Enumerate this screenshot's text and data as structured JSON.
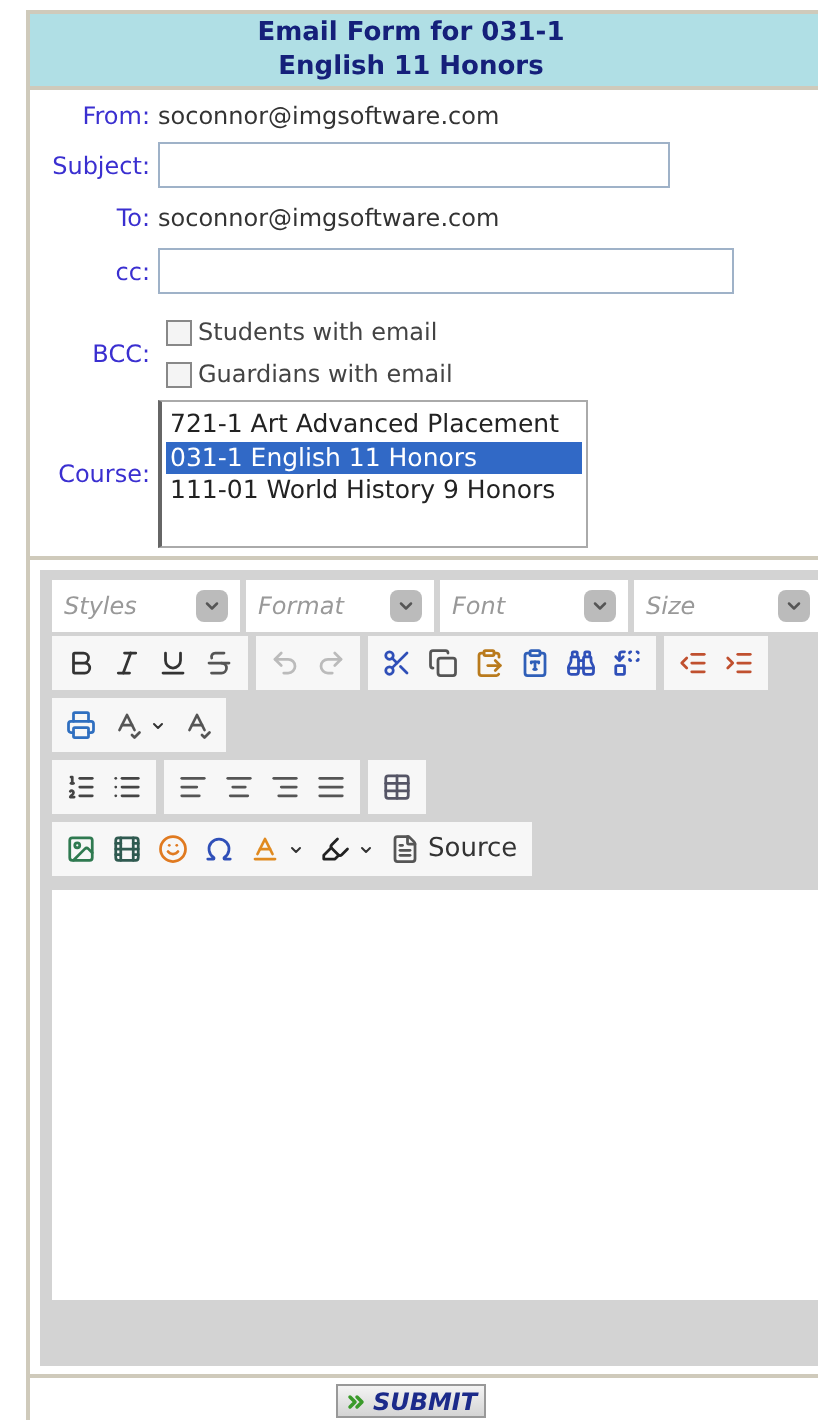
{
  "header": {
    "title": "Email Form for 031-1",
    "subtitle": "English 11 Honors"
  },
  "form": {
    "from": {
      "label": "From:",
      "value": "soconnor@imgsoftware.com"
    },
    "subject": {
      "label": "Subject:"
    },
    "to": {
      "label": "To:",
      "value": "soconnor@imgsoftware.com"
    },
    "cc": {
      "label": "cc:"
    },
    "bcc": {
      "label": "BCC:",
      "options": [
        {
          "label": "Students with email",
          "checked": false
        },
        {
          "label": "Guardians with email",
          "checked": false
        }
      ]
    },
    "course": {
      "label": "Course:",
      "options": [
        {
          "label": "721-1 Art Advanced Placement",
          "selected": false
        },
        {
          "label": "031-1 English 11 Honors",
          "selected": true
        },
        {
          "label": "111-01 World History 9 Honors",
          "selected": false
        }
      ]
    }
  },
  "editor": {
    "combos": [
      {
        "placeholder": "Styles"
      },
      {
        "placeholder": "Format"
      },
      {
        "placeholder": "Font"
      },
      {
        "placeholder": "Size"
      }
    ],
    "toolbar_rows": [
      [
        [
          {
            "kind": "bold",
            "disabled": false
          },
          {
            "kind": "italic",
            "disabled": false
          },
          {
            "kind": "underline",
            "disabled": false
          },
          {
            "kind": "strike",
            "disabled": false
          }
        ],
        [
          {
            "kind": "undo",
            "disabled": true
          },
          {
            "kind": "redo",
            "disabled": true
          }
        ],
        [
          {
            "kind": "cut",
            "disabled": false
          },
          {
            "kind": "copy",
            "disabled": false
          },
          {
            "kind": "paste",
            "disabled": false
          },
          {
            "kind": "paste-word",
            "disabled": false
          },
          {
            "kind": "find",
            "disabled": false
          },
          {
            "kind": "replace",
            "disabled": false
          }
        ],
        [
          {
            "kind": "outdent",
            "disabled": false
          },
          {
            "kind": "indent",
            "disabled": false
          }
        ]
      ],
      [
        [
          {
            "kind": "print",
            "disabled": false
          },
          {
            "kind": "spell-menu",
            "disabled": false
          },
          {
            "kind": "spell",
            "disabled": false
          }
        ]
      ],
      [
        [
          {
            "kind": "ordered-list",
            "disabled": false
          },
          {
            "kind": "bullet-list",
            "disabled": false
          }
        ],
        [
          {
            "kind": "align-left",
            "disabled": false
          },
          {
            "kind": "align-center",
            "disabled": false
          },
          {
            "kind": "align-right",
            "disabled": false
          },
          {
            "kind": "justify",
            "disabled": false
          }
        ],
        [
          {
            "kind": "table",
            "disabled": false
          }
        ]
      ],
      [
        [
          {
            "kind": "image",
            "disabled": false
          },
          {
            "kind": "flash",
            "disabled": false
          },
          {
            "kind": "smiley",
            "disabled": false
          },
          {
            "kind": "omega",
            "disabled": false
          },
          {
            "kind": "text-color",
            "disabled": false
          },
          {
            "kind": "bg-color",
            "disabled": false
          },
          {
            "kind": "source",
            "disabled": false,
            "label": "Source"
          }
        ]
      ]
    ]
  },
  "submit": {
    "label": "SUBMIT"
  }
}
